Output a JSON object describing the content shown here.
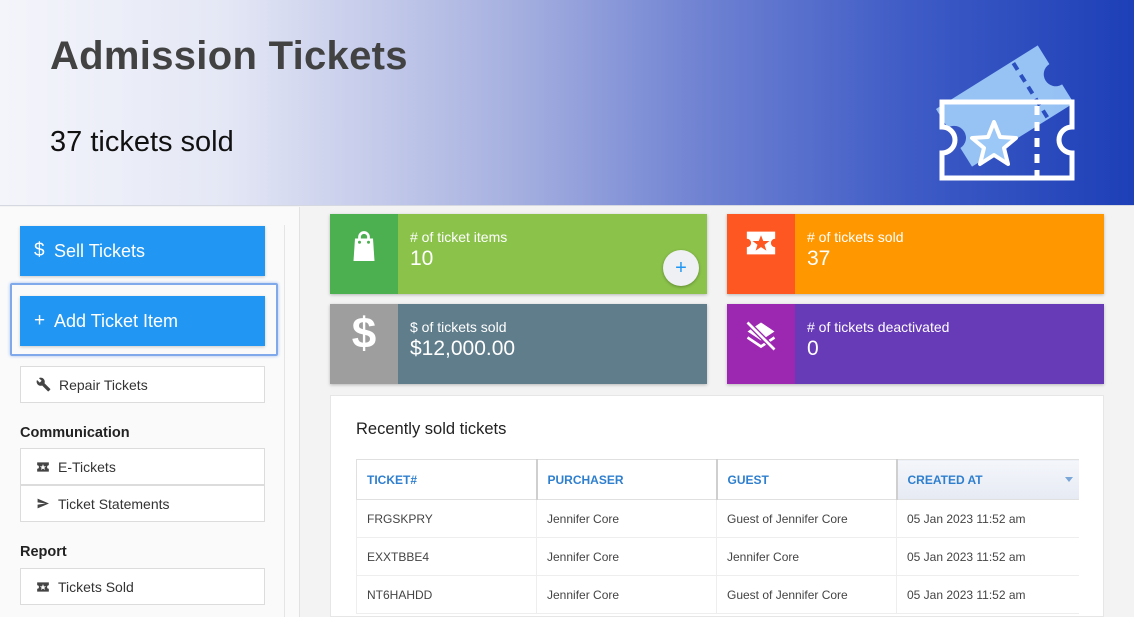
{
  "banner": {
    "title": "Admission Tickets",
    "subtitle": "37 tickets sold",
    "art_icon": "ticket-star-icon"
  },
  "sidebar": {
    "sell_label": "Sell Tickets",
    "add_label": "Add Ticket Item",
    "repair_label": "Repair Tickets",
    "sections": {
      "communication": {
        "title": "Communication",
        "items": [
          {
            "label": "E-Tickets",
            "icon": "ticket-icon"
          },
          {
            "label": "Ticket Statements",
            "icon": "send-icon"
          }
        ]
      },
      "report": {
        "title": "Report",
        "items": [
          {
            "label": "Tickets Sold",
            "icon": "ticket-icon"
          }
        ]
      }
    }
  },
  "stats": [
    {
      "label": "# of ticket items",
      "value": "10",
      "icon": "shopping-bag-icon",
      "color": "#8bc34a",
      "icon_bg": "#4caf50"
    },
    {
      "label": "# of tickets sold",
      "value": "37",
      "icon": "ticket-star-icon",
      "color": "#ff9800",
      "icon_bg": "#ff5722"
    },
    {
      "label": "$ of tickets sold",
      "value": "$12,000.00",
      "icon": "dollar-icon",
      "color": "#607d8b",
      "icon_bg": "#9e9e9e"
    },
    {
      "label": "# of tickets deactivated",
      "value": "0",
      "icon": "layers-off-icon",
      "color": "#673ab7",
      "icon_bg": "#9c27b0"
    }
  ],
  "recent": {
    "title": "Recently sold tickets",
    "columns": [
      "TICKET#",
      "PURCHASER",
      "GUEST",
      "CREATED AT"
    ],
    "rows": [
      [
        "FRGSKPRY",
        "Jennifer Core",
        "Guest of Jennifer Core",
        "05 Jan 2023 11:52 am"
      ],
      [
        "EXXTBBE4",
        "Jennifer Core",
        "Jennifer Core",
        "05 Jan 2023 11:52 am"
      ],
      [
        "NT6HAHDD",
        "Jennifer Core",
        "Guest of Jennifer Core",
        "05 Jan 2023 11:52 am"
      ]
    ]
  },
  "colors": {
    "primary": "#2196f3",
    "header_link": "#2f7fcf"
  }
}
